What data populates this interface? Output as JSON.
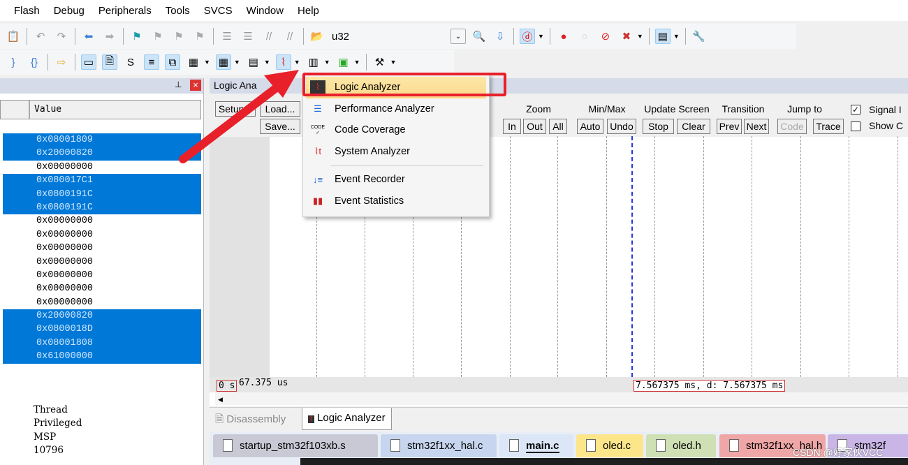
{
  "menubar": [
    "Flash",
    "Debug",
    "Peripherals",
    "Tools",
    "SVCS",
    "Window",
    "Help"
  ],
  "toolbar1": {
    "target_select": "u32"
  },
  "left_panel": {
    "column_header": "Value",
    "rows": [
      {
        "v": "0x08001809",
        "hl": true
      },
      {
        "v": "0x20000820",
        "hl": true
      },
      {
        "v": "0x00000000",
        "hl": false
      },
      {
        "v": "0x080017C1",
        "hl": true
      },
      {
        "v": "0x0800191C",
        "hl": true
      },
      {
        "v": "0x0800191C",
        "hl": true
      },
      {
        "v": "0x00000000",
        "hl": false
      },
      {
        "v": "0x00000000",
        "hl": false
      },
      {
        "v": "0x00000000",
        "hl": false
      },
      {
        "v": "0x00000000",
        "hl": false
      },
      {
        "v": "0x00000000",
        "hl": false
      },
      {
        "v": "0x00000000",
        "hl": false
      },
      {
        "v": "0x00000000",
        "hl": false
      },
      {
        "v": "0x20000820",
        "hl": true
      },
      {
        "v": "0x0800018D",
        "hl": true
      },
      {
        "v": "0x08001808",
        "hl": true
      },
      {
        "v": "0x61000000",
        "hl": true
      }
    ],
    "extra": [
      "Thread",
      "Privileged",
      "MSP",
      "10796"
    ],
    "pin": "⊥",
    "close": "×"
  },
  "logic_analyzer": {
    "title": "Logic Ana",
    "setup": "Setup...",
    "load": "Load...",
    "save": "Save...",
    "zoom": {
      "label": "Zoom",
      "in": "In",
      "out": "Out",
      "all": "All"
    },
    "minmax": {
      "label": "Min/Max",
      "auto": "Auto",
      "undo": "Undo"
    },
    "update": {
      "label": "Update Screen",
      "stop": "Stop",
      "clear": "Clear"
    },
    "transition": {
      "label": "Transition",
      "prev": "Prev",
      "next": "Next"
    },
    "jump": {
      "label": "Jump to",
      "code": "Code",
      "trace": "Trace"
    },
    "signal_info": {
      "label": "Signal I",
      "checked": true
    },
    "show_cycles": {
      "label": "Show C",
      "checked": false
    },
    "time_start": "0 s",
    "time_offset": "67.375 us",
    "cursor_readout": "7.567375 ms,  d: 7.567375 ms"
  },
  "dropdown": {
    "items": [
      {
        "label": "Logic Analyzer",
        "icon": "logic-analyzer-icon",
        "highlighted": true
      },
      {
        "label": "Performance Analyzer",
        "icon": "performance-analyzer-icon"
      },
      {
        "label": "Code Coverage",
        "icon": "code-coverage-icon",
        "glyph": "CODE"
      },
      {
        "label": "System Analyzer",
        "icon": "system-analyzer-icon"
      },
      {
        "label": "Event Recorder",
        "icon": "event-recorder-icon"
      },
      {
        "label": "Event Statistics",
        "icon": "event-statistics-icon"
      }
    ]
  },
  "bottom_tabs": [
    {
      "label": "Disassembly",
      "active": false
    },
    {
      "label": "Logic Analyzer",
      "active": true
    }
  ],
  "file_tabs": [
    {
      "label": "startup_stm32f103xb.s",
      "color": "#c9c9d6"
    },
    {
      "label": "stm32f1xx_hal.c",
      "color": "#c7d6ee"
    },
    {
      "label": "main.c",
      "color": "#dbe7f7",
      "active": true
    },
    {
      "label": "oled.c",
      "color": "#fde58a"
    },
    {
      "label": "oled.h",
      "color": "#cfe0b4"
    },
    {
      "label": "stm32f1xx_hal.h",
      "color": "#efa6a6"
    },
    {
      "label": "stm32f",
      "color": "#c9b6e6"
    }
  ],
  "watermark": "CSDN @好家伙VCC",
  "colors": {
    "selection": "#0078d7",
    "highlight_box": "#e8202a",
    "menu_hover": "#fbd88a"
  }
}
